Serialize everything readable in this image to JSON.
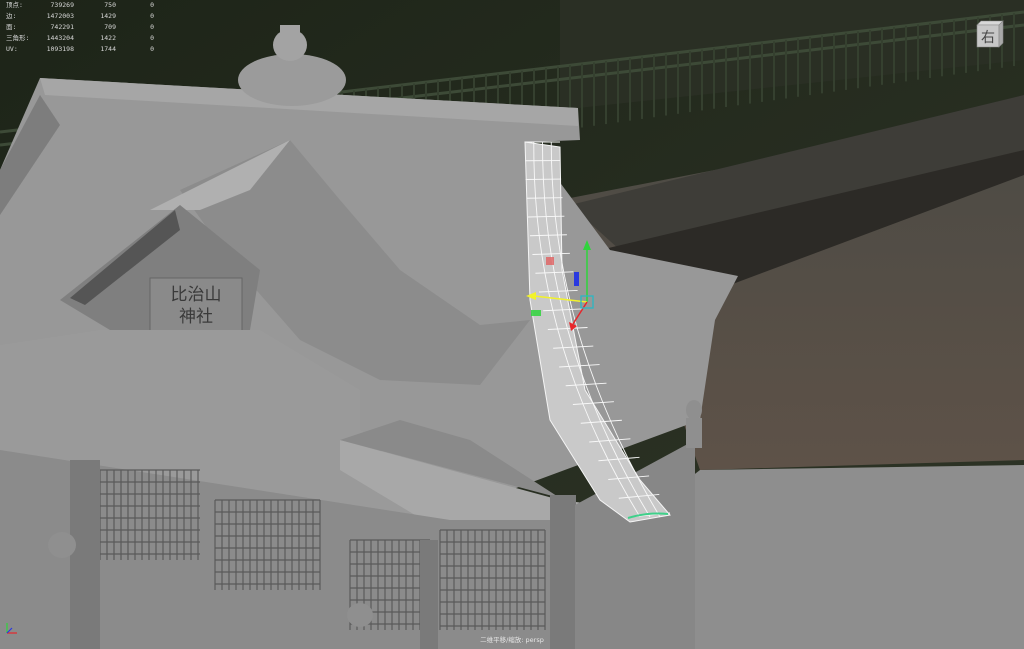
{
  "viewport": {
    "camera_label": "二维平移/缩放: persp"
  },
  "heads_up_display": {
    "rows": [
      {
        "label": "顶点:",
        "values": [
          "739269",
          "750",
          "0"
        ]
      },
      {
        "label": "边:",
        "values": [
          "1472003",
          "1429",
          "0"
        ]
      },
      {
        "label": "面:",
        "values": [
          "742291",
          "709",
          "0"
        ]
      },
      {
        "label": "三角形:",
        "values": [
          "1443204",
          "1422",
          "0"
        ]
      },
      {
        "label": "UV:",
        "values": [
          "1093198",
          "1744",
          "0"
        ]
      }
    ]
  },
  "view_cube": {
    "face_label": "右"
  },
  "scene": {
    "plaque_lines": [
      "比治山",
      "神社"
    ]
  },
  "colors": {
    "model_gray": "#8e8e8e",
    "roof_light": "#9a9a9a",
    "background_road": "#5a5147",
    "manipulator_x": "#e8262b",
    "manipulator_y": "#2fd43c",
    "manipulator_z": "#2a3ae0",
    "manipulator_center": "#2bb7c4",
    "manipulator_view": "#f2f22a"
  },
  "icons": {
    "view_cube": "view-cube-icon",
    "axis_indicator": "axis-triad-icon",
    "move_manipulator": "move-tool-gizmo-icon"
  }
}
